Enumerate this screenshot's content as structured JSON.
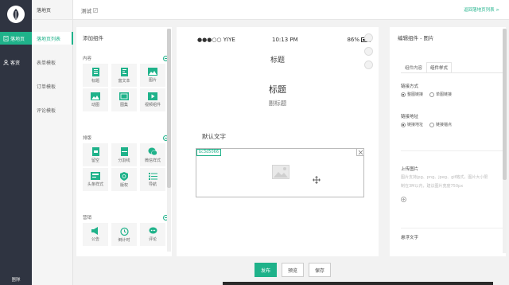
{
  "rail": {
    "items": [
      {
        "label": "落地页",
        "icon": "page-icon",
        "active": true
      },
      {
        "label": "客资",
        "icon": "user-icon",
        "active": false
      }
    ],
    "footer": "團隊"
  },
  "subnav": {
    "header": "落地页",
    "items": [
      {
        "label": "落地页列表",
        "active": true
      },
      {
        "label": "表单模板",
        "active": false
      },
      {
        "label": "订单模板",
        "active": false
      },
      {
        "label": "评论模板",
        "active": false
      }
    ]
  },
  "topbar": {
    "title": "测试",
    "back_link": "返回落地页列表 >"
  },
  "components": {
    "title": "添加组件",
    "sections": [
      {
        "name": "内容",
        "items": [
          {
            "label": "标题",
            "icon": "title-icon"
          },
          {
            "label": "富文本",
            "icon": "rich-text-icon"
          },
          {
            "label": "图片",
            "icon": "image-icon"
          },
          {
            "label": "动图",
            "icon": "gif-icon"
          },
          {
            "label": "图集",
            "icon": "gallery-icon"
          },
          {
            "label": "视频组件",
            "icon": "video-icon"
          }
        ]
      },
      {
        "name": "排版",
        "items": [
          {
            "label": "留空",
            "icon": "blank-icon"
          },
          {
            "label": "分割线",
            "icon": "divider-icon"
          },
          {
            "label": "微信样式",
            "icon": "wechat-icon"
          },
          {
            "label": "头条样式",
            "icon": "headline-icon"
          },
          {
            "label": "版权",
            "icon": "copyright-icon"
          },
          {
            "label": "导航",
            "icon": "nav-icon"
          }
        ]
      },
      {
        "name": "营销",
        "items": [
          {
            "label": "公告",
            "icon": "announce-icon"
          },
          {
            "label": "倒计时",
            "icon": "countdown-icon"
          },
          {
            "label": "评论",
            "icon": "comment-icon"
          }
        ]
      }
    ]
  },
  "preview": {
    "carrier": "●●●○○ YIYE",
    "time": "10:13 PM",
    "battery": "86%",
    "nav_title": "标题",
    "heading": "标题",
    "subheading": "副标题",
    "default_text": "默认文字",
    "image_tag": "bc3d5066"
  },
  "editor": {
    "title": "编辑组件 - 图片",
    "tabs": [
      {
        "label": "组件内容",
        "active": false
      },
      {
        "label": "组件样式",
        "active": true
      }
    ],
    "link_type_label": "链接方式",
    "link_type_options": [
      {
        "label": "整图链接",
        "on": true
      },
      {
        "label": "单图链接",
        "on": false
      }
    ],
    "link_addr_label": "链接地址",
    "link_addr_options": [
      {
        "label": "链接地址",
        "on": true
      },
      {
        "label": "链接锚点",
        "on": false
      }
    ],
    "upload_label": "上传图片",
    "upload_hint_1": "图片支持jpg、png、jpeg、gif格式，图片大小限",
    "upload_hint_2": "制在3M以内，建议图片宽度750px",
    "float_text_label": "悬浮文字"
  },
  "actions": {
    "publish": "发布",
    "preview": "预览",
    "save": "保存"
  },
  "colors": {
    "accent": "#1fb28a",
    "rail_bg": "#2f3441"
  }
}
